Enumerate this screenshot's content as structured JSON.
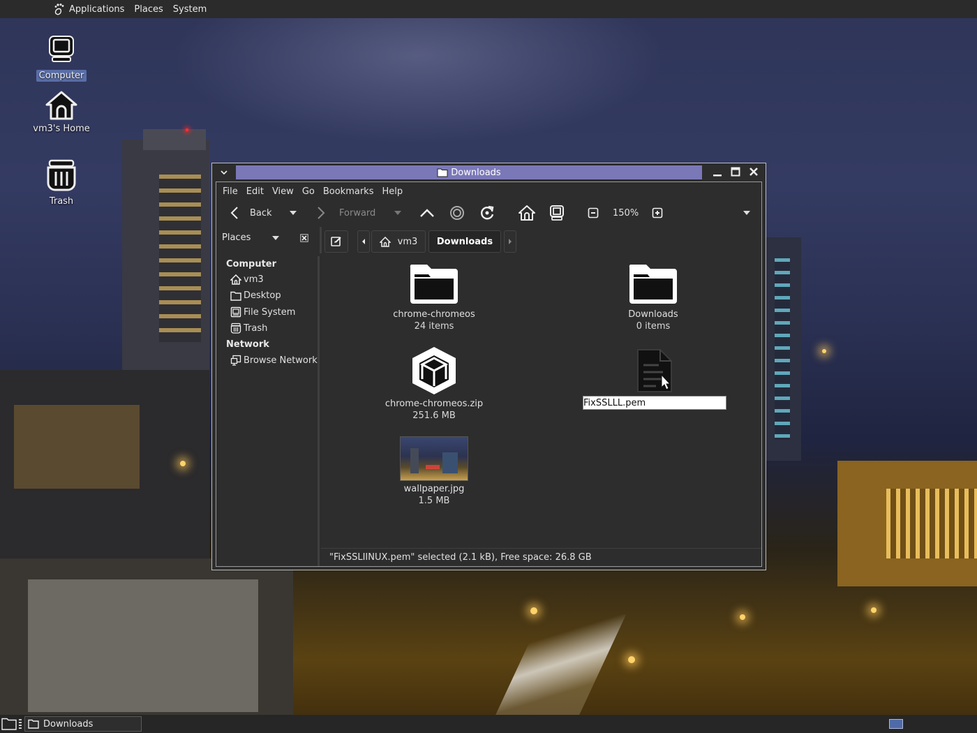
{
  "top_panel": {
    "applications": "Applications",
    "places": "Places",
    "system": "System"
  },
  "desktop_icons": [
    {
      "label": "Computer",
      "icon": "computer-icon",
      "selected": true
    },
    {
      "label": "vm3's Home",
      "icon": "home-icon",
      "selected": false
    },
    {
      "label": "Trash",
      "icon": "trash-icon",
      "selected": false
    }
  ],
  "window": {
    "title": "Downloads",
    "menu": [
      "File",
      "Edit",
      "View",
      "Go",
      "Bookmarks",
      "Help"
    ],
    "toolbar": {
      "back": "Back",
      "forward": "Forward",
      "zoom": "150%"
    },
    "location": {
      "places_label": "Places",
      "crumbs": [
        "vm3",
        "Downloads"
      ]
    },
    "sidebar": {
      "computer_heading": "Computer",
      "computer_items": [
        {
          "label": "vm3",
          "icon": "home-icon"
        },
        {
          "label": "Desktop",
          "icon": "folder-icon"
        },
        {
          "label": "File System",
          "icon": "drive-icon"
        },
        {
          "label": "Trash",
          "icon": "trash-icon"
        }
      ],
      "network_heading": "Network",
      "network_items": [
        {
          "label": "Browse Network",
          "icon": "network-icon"
        }
      ]
    },
    "files": [
      {
        "name": "chrome-chromeos",
        "meta": "24 items",
        "icon": "folder-icon"
      },
      {
        "name": "Downloads",
        "meta": "0 items",
        "icon": "folder-icon"
      },
      {
        "name": "chrome-chromeos.zip",
        "meta": "251.6 MB",
        "icon": "package-icon"
      },
      {
        "name": "FixSSLLL.pem",
        "meta": "",
        "icon": "document-icon",
        "renaming": true
      },
      {
        "name": "wallpaper.jpg",
        "meta": "1.5 MB",
        "icon": "image-thumbnail"
      }
    ],
    "status": "\"FixSSLIINUX.pem\" selected (2.1 kB), Free space: 26.8 GB"
  },
  "taskbar": {
    "task_label": "Downloads"
  },
  "colors": {
    "title_strip": "#7b78b8",
    "panel": "#2b2b2b",
    "window_bg": "#2d2d2d",
    "selection": "#5a6ea8"
  }
}
